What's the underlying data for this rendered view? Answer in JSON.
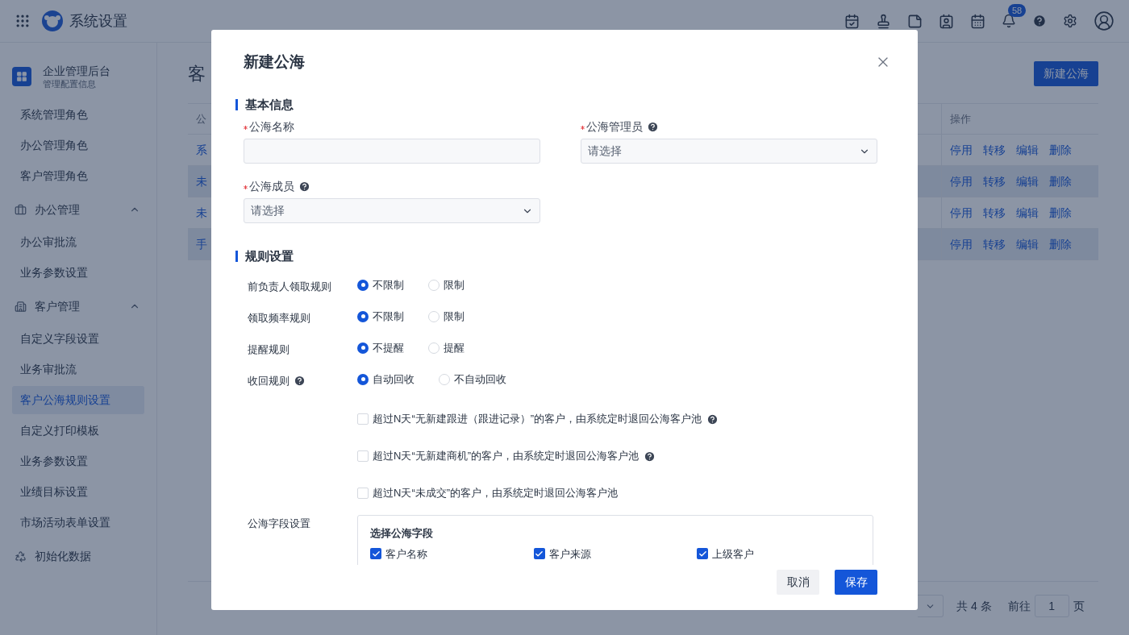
{
  "topbar": {
    "title": "系统设置",
    "notification_count": "58"
  },
  "sidebar": {
    "header": {
      "title": "企业管理后台",
      "subtitle": "管理配置信息"
    },
    "items": [
      {
        "kind": "item",
        "label": "系统管理角色",
        "selected": false
      },
      {
        "kind": "item",
        "label": "办公管理角色",
        "selected": false
      },
      {
        "kind": "item",
        "label": "客户管理角色",
        "selected": false
      },
      {
        "kind": "group",
        "label": "办公管理",
        "expanded": true,
        "children": [
          {
            "label": "办公审批流",
            "selected": false
          },
          {
            "label": "业务参数设置",
            "selected": false
          }
        ]
      },
      {
        "kind": "group",
        "label": "客户管理",
        "expanded": true,
        "children": [
          {
            "label": "自定义字段设置",
            "selected": false
          },
          {
            "label": "业务审批流",
            "selected": false
          },
          {
            "label": "客户公海规则设置",
            "selected": true
          },
          {
            "label": "自定义打印模板",
            "selected": false
          },
          {
            "label": "业务参数设置",
            "selected": false
          },
          {
            "label": "业绩目标设置",
            "selected": false
          },
          {
            "label": "市场活动表单设置",
            "selected": false
          }
        ]
      },
      {
        "kind": "link",
        "label": "初始化数据"
      }
    ]
  },
  "main": {
    "heading": "客",
    "new_button": "新建公海",
    "table": {
      "columns": [
        "公",
        "操作"
      ],
      "rows": [
        {
          "cell": "系",
          "striped": false,
          "actions": [
            "停用",
            "转移",
            "编辑",
            "删除"
          ]
        },
        {
          "cell": "未",
          "striped": true,
          "actions": [
            "停用",
            "转移",
            "编辑",
            "删除"
          ]
        },
        {
          "cell": "未",
          "striped": false,
          "actions": [
            "停用",
            "转移",
            "编辑",
            "删除"
          ]
        },
        {
          "cell": "手",
          "striped": true,
          "actions": [
            "停用",
            "转移",
            "编辑",
            "删除"
          ]
        }
      ]
    },
    "pagination": {
      "total": "共 4 条",
      "goto_label": "前往",
      "page": "1",
      "page_suffix": "页"
    }
  },
  "modal": {
    "title": "新建公海",
    "basic": {
      "title": "基本信息",
      "fields": [
        {
          "kind": "input",
          "label": "公海名称",
          "required": true,
          "help": false
        },
        {
          "kind": "select",
          "label": "公海管理员",
          "required": true,
          "help": true,
          "placeholder": "请选择"
        },
        {
          "kind": "select",
          "label": "公海成员",
          "required": true,
          "help": true,
          "placeholder": "请选择"
        }
      ]
    },
    "rules": {
      "title": "规则设置",
      "items": [
        {
          "label": "前负责人领取规则",
          "help": false,
          "options": [
            {
              "label": "不限制",
              "selected": true
            },
            {
              "label": "限制",
              "selected": false
            }
          ]
        },
        {
          "label": "领取频率规则",
          "help": false,
          "options": [
            {
              "label": "不限制",
              "selected": true
            },
            {
              "label": "限制",
              "selected": false
            }
          ]
        },
        {
          "label": "提醒规则",
          "help": false,
          "options": [
            {
              "label": "不提醒",
              "selected": true
            },
            {
              "label": "提醒",
              "selected": false
            }
          ]
        },
        {
          "label": "收回规则",
          "help": true,
          "options": [
            {
              "label": "自动回收",
              "selected": true
            },
            {
              "label": "不自动回收",
              "selected": false
            }
          ]
        }
      ],
      "conditions": [
        {
          "label": "超过N天“无新建跟进（跟进记录）”的客户，由系统定时退回公海客户池",
          "checked": false,
          "help": true
        },
        {
          "label": "超过N天“无新建商机”的客户，由系统定时退回公海客户池",
          "checked": false,
          "help": true
        },
        {
          "label": "超过N天“未成交”的客户，由系统定时退回公海客户池",
          "checked": false,
          "help": false
        }
      ]
    },
    "field_settings": {
      "label": "公海字段设置",
      "box_title": "选择公海字段",
      "fields": [
        {
          "label": "客户名称",
          "checked": true
        },
        {
          "label": "客户来源",
          "checked": true
        },
        {
          "label": "上级客户",
          "checked": true
        }
      ]
    },
    "buttons": [
      {
        "kind": "secondary",
        "label": "取消"
      },
      {
        "kind": "primary",
        "label": "保存"
      }
    ]
  }
}
